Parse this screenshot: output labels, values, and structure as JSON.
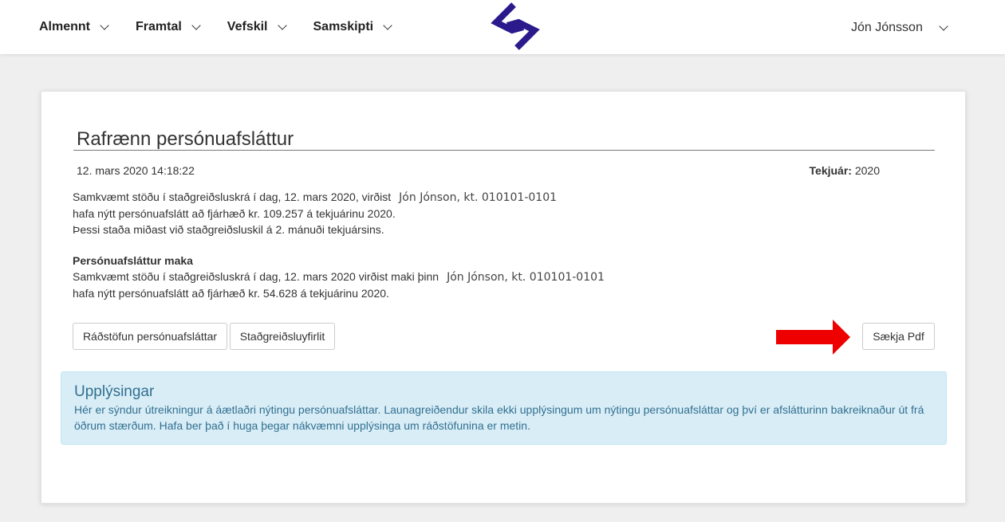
{
  "nav": {
    "items": [
      {
        "label": "Almennt"
      },
      {
        "label": "Framtal"
      },
      {
        "label": "Vefskil"
      },
      {
        "label": "Samskipti"
      }
    ],
    "user_name": "Jón Jónsson"
  },
  "colors": {
    "logo": "#2a1a8c",
    "arrow": "#ee0000",
    "info_bg": "#d9edf7",
    "info_text": "#31708f"
  },
  "page": {
    "title": "Rafrænn persónuafsláttur",
    "date": "12. mars 2020 14:18:22",
    "year_label": "Tekjuár:",
    "year_value": "2020",
    "para1": {
      "line1": "Samkvæmt stöðu í staðgreiðsluskrá í dag, 12. mars 2020, virðist",
      "name": "Jón Jónson, kt. 010101-0101",
      "line2": "hafa nýtt persónuafslátt að fjárhæð kr. 109.257 á tekjuárinu 2020.",
      "line3": "Þessi staða miðast við staðgreiðsluskil á 2. mánuði tekjuársins."
    },
    "para2": {
      "heading": "Persónuafsláttur maka",
      "line1": "Samkvæmt stöðu í staðgreiðsluskrá í dag, 12. mars 2020 virðist maki þinn",
      "name": "Jón Jónson, kt. 010101-0101",
      "line2": "hafa nýtt persónuafslátt að fjárhæð kr. 54.628 á tekjuárinu 2020."
    },
    "buttons": {
      "allocation": "Ráðstöfun persónuafsláttar",
      "summary": "Staðgreiðsluyfirlit",
      "download_pdf": "Sækja Pdf"
    },
    "info": {
      "title": "Upplýsingar",
      "text": "Hér er sýndur útreikningur á áætlaðri nýtingu persónuafsláttar. Launagreiðendur skila ekki upplýsingum um nýtingu persónuafsláttar og því er afslátturinn bakreiknaður út frá öðrum stærðum. Hafa ber það í huga þegar nákvæmni upplýsinga um ráðstöfunina er metin."
    }
  }
}
